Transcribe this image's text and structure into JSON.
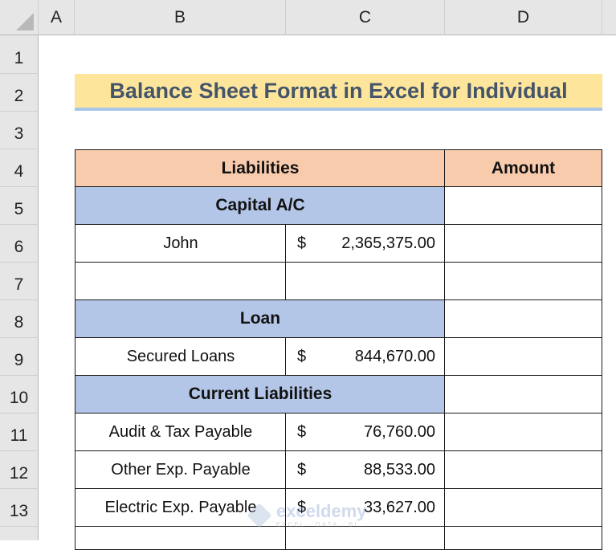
{
  "columns": [
    "A",
    "B",
    "C",
    "D"
  ],
  "rows": [
    "1",
    "2",
    "3",
    "4",
    "5",
    "6",
    "7",
    "8",
    "9",
    "10",
    "11",
    "12",
    "13"
  ],
  "title": "Balance Sheet Format in Excel for Individual",
  "table": {
    "header": {
      "liabilities": "Liabilities",
      "amount": "Amount"
    },
    "sections": {
      "capital": "Capital A/C",
      "loan": "Loan",
      "current": "Current Liabilities"
    },
    "items": [
      {
        "label": "John",
        "currency": "$",
        "value": "2,365,375.00"
      },
      {
        "label": "",
        "currency": "",
        "value": ""
      },
      {
        "label": "Secured Loans",
        "currency": "$",
        "value": "844,670.00"
      },
      {
        "label": "Audit & Tax Payable",
        "currency": "$",
        "value": "76,760.00"
      },
      {
        "label": "Other Exp. Payable",
        "currency": "$",
        "value": "88,533.00"
      },
      {
        "label": "Electric Exp. Payable",
        "currency": "$",
        "value": "33,627.00"
      }
    ]
  },
  "watermark": {
    "name": "exceldemy",
    "tagline": "EXCEL · DATA · BI"
  },
  "colors": {
    "title_bg": "#fde69b",
    "title_text": "#44546a",
    "header_bg": "#f8cbad",
    "section_bg": "#b4c6e7"
  }
}
